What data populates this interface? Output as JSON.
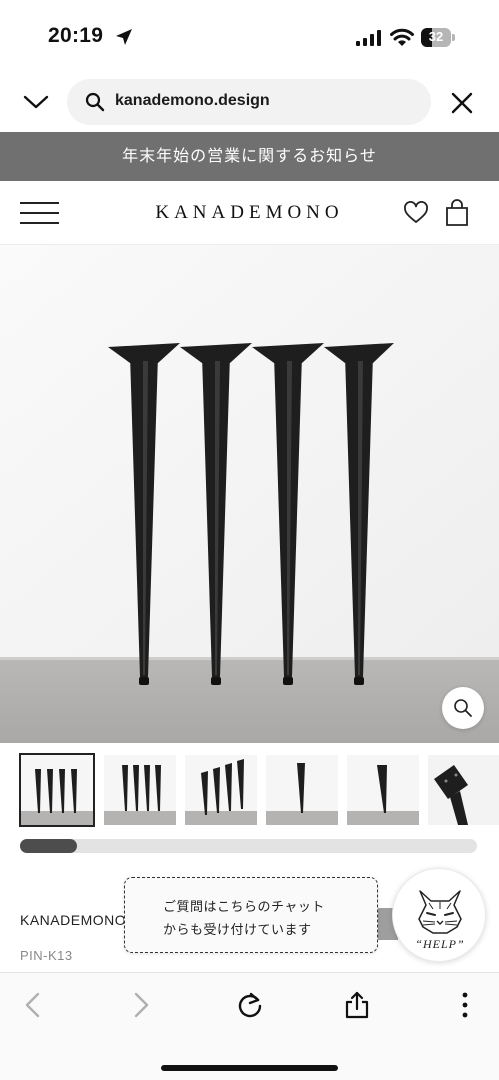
{
  "status_bar": {
    "time": "20:19",
    "battery_level": "32",
    "battery_fraction": 0.32
  },
  "browser": {
    "url": "kanademono.design",
    "icons": [
      "chevron-down-icon",
      "search-icon",
      "close-icon"
    ]
  },
  "announcement": {
    "text": "年末年始の営業に関するお知らせ"
  },
  "site_header": {
    "logo": "KANADEMONO",
    "icons": [
      "hamburger-menu-icon",
      "heart-icon",
      "shopping-bag-icon"
    ]
  },
  "gallery": {
    "thumbnail_count": 6,
    "selected_index": 0,
    "scroll_position_fraction": 0.12,
    "icons": [
      "zoom-icon"
    ]
  },
  "product": {
    "brand": "KANADEMONO",
    "sku": "PIN-K13"
  },
  "chat": {
    "line1": "ご質問はこちらのチャット",
    "line2": "からも受け付けています",
    "help_label": "“HELP”"
  },
  "toolbar": {
    "icons": [
      "back-icon",
      "forward-icon",
      "reload-icon",
      "share-icon",
      "more-icon"
    ]
  },
  "colors": {
    "announcement_bg": "#707070",
    "leg_color": "#1e1e1e",
    "progress_fill": "#4d4d4d",
    "progress_track": "#e3e3e3"
  }
}
